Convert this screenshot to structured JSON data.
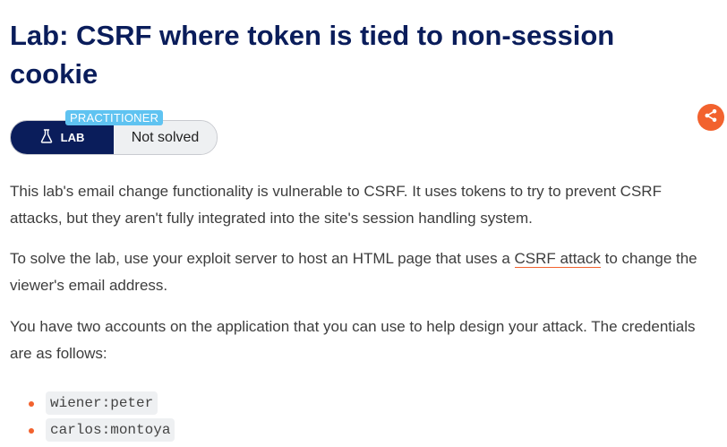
{
  "page": {
    "title": "Lab: CSRF where token is tied to non-session cookie"
  },
  "share": {
    "icon": "share-icon",
    "color": "#f2622e"
  },
  "badge": {
    "level": "PRACTITIONER",
    "lab_label": "LAB",
    "lab_icon": "flask-icon",
    "status": "Not solved",
    "colors": {
      "lab_bg": "#0a1d5b",
      "level_bg": "#5fc3f1"
    }
  },
  "description": {
    "p1": "This lab's email change functionality is vulnerable to CSRF. It uses tokens to try to prevent CSRF attacks, but they aren't fully integrated into the site's session handling system.",
    "p2_before": "To solve the lab, use your exploit server to host an HTML page that uses a ",
    "p2_link": "CSRF attack",
    "p2_after": " to change the viewer's email address.",
    "p3": "You have two accounts on the application that you can use to help design your attack. The credentials are as follows:"
  },
  "credentials": [
    "wiener:peter",
    "carlos:montoya"
  ]
}
